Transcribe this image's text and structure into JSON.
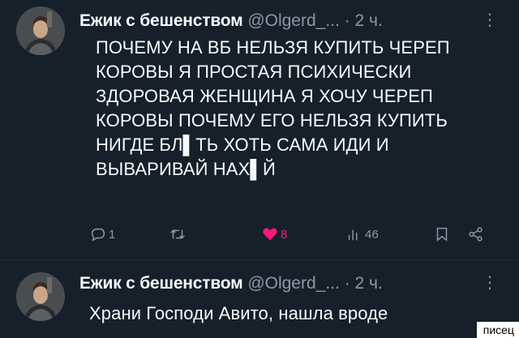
{
  "tweets": [
    {
      "author": "Ежик с бешенством",
      "handle": "@Olgerd_...",
      "dot": "·",
      "time": "2 ч.",
      "text_lines": [
        "ПОЧЕМУ НА ВБ НЕЛЬЗЯ КУПИТЬ ЧЕРЕП",
        "КОРОВЫ Я ПРОСТАЯ ПСИХИЧЕСКИ",
        "ЗДОРОВАЯ ЖЕНЩИНА Я ХОЧУ ЧЕРЕП",
        "КОРОВЫ ПОЧЕМУ ЕГО НЕЛЬЗЯ КУПИТЬ",
        "НИГДЕ БЛ▌ТЬ ХОТЬ САМА ИДИ И",
        "ВЫВАРИВАЙ НАХ▌Й"
      ],
      "actions": {
        "replies": "1",
        "retweets": "",
        "likes": "8",
        "views": "46"
      },
      "icons": [
        "reply-icon",
        "retweet-icon",
        "heart-icon",
        "views-icon",
        "bookmark-icon",
        "share-icon"
      ]
    },
    {
      "author": "Ежик с бешенством",
      "handle": "@Olgerd_...",
      "dot": "·",
      "time": "2 ч.",
      "text_lines": [
        "Храни Господи Авито, нашла вроде"
      ]
    }
  ],
  "watermark": "писец",
  "colors": {
    "background": "#15202b",
    "text": "#f7f9f9",
    "secondary": "#8b98a5",
    "like": "#f91880"
  }
}
